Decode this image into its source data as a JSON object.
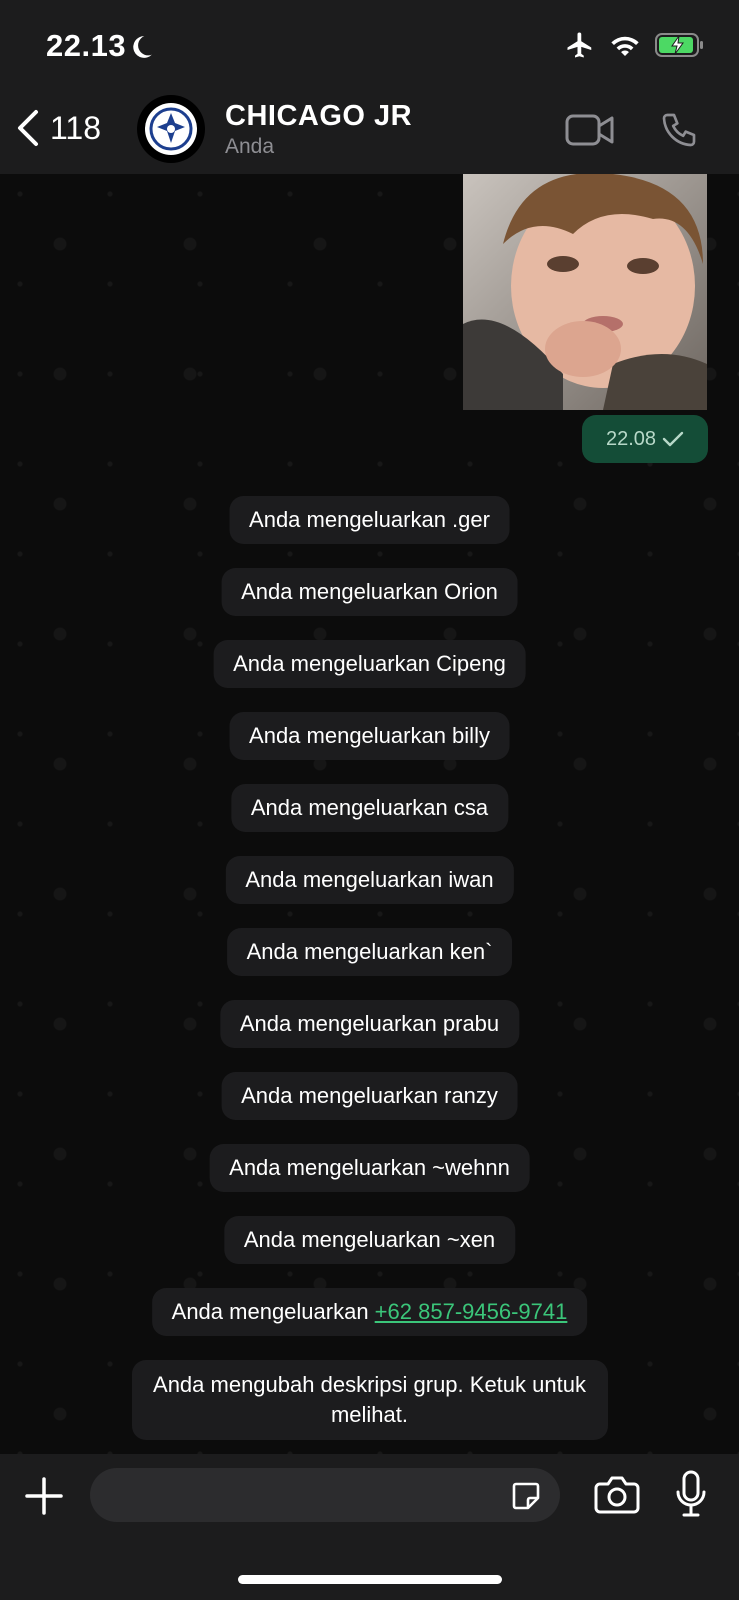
{
  "status": {
    "time": "22.13"
  },
  "header": {
    "back_count": "118",
    "title": "CHICAGO JR",
    "subtitle": "Anda"
  },
  "messages": {
    "photo_time": "22.08",
    "system": [
      "Anda mengeluarkan .ger",
      "Anda mengeluarkan Orion",
      "Anda mengeluarkan Cipeng",
      "Anda mengeluarkan billy",
      "Anda mengeluarkan csa",
      "Anda mengeluarkan iwan",
      "Anda mengeluarkan ken`",
      "Anda mengeluarkan prabu",
      "Anda mengeluarkan ranzy",
      "Anda mengeluarkan ~wehnn",
      "Anda mengeluarkan ~xen"
    ],
    "removed_number_prefix": "Anda mengeluarkan ",
    "removed_number": "+62 857-9456-9741",
    "description_changed": "Anda mengubah deskripsi grup. Ketuk untuk melihat."
  },
  "colors": {
    "accent_green": "#3bc67a",
    "outgoing_bubble": "#144d37",
    "battery_green": "#4cd964"
  }
}
